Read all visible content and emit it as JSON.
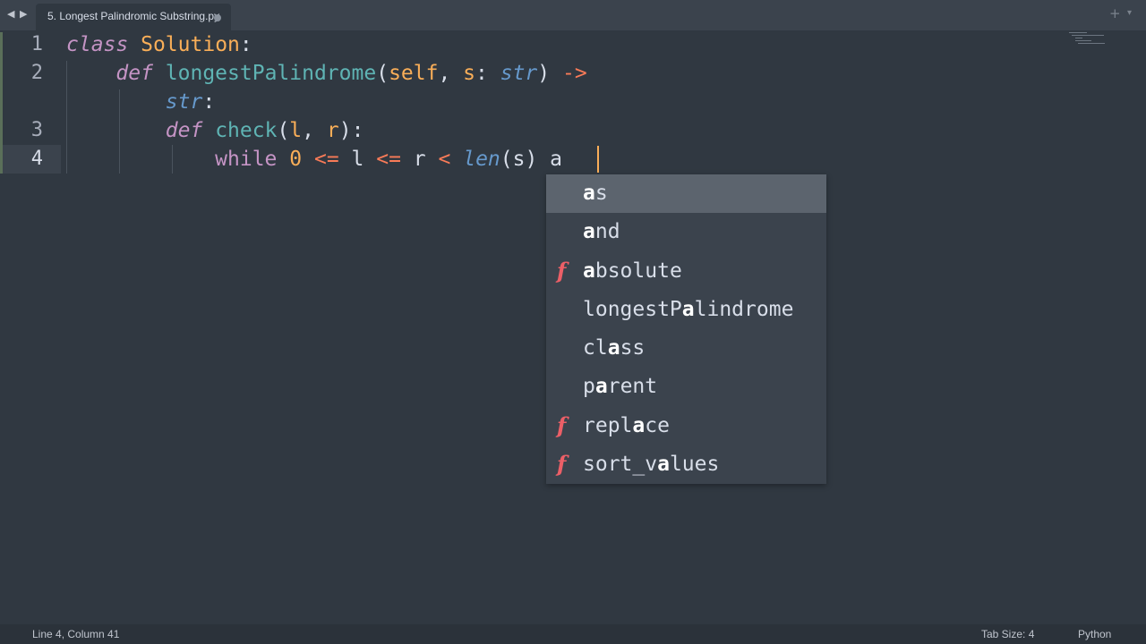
{
  "tab": {
    "title": "5. Longest Palindromic Substring.py"
  },
  "icons": {
    "back": "triangle-left-icon",
    "forward": "triangle-right-icon",
    "dirty": "dot-icon",
    "add": "plus-icon",
    "menu": "chevron-down-icon",
    "function": "f-function-icon"
  },
  "glyphs": {
    "back": "◀",
    "forward": "▶",
    "add": "+",
    "menu": "▾",
    "function": "f"
  },
  "editor": {
    "line_numbers": [
      "1",
      "2",
      "3",
      "4"
    ],
    "lines": {
      "l1": [
        "class",
        " ",
        "Solution",
        ":"
      ],
      "l2": [
        "    ",
        "def",
        " ",
        "longestPalindrome",
        "(",
        "self",
        ", ",
        "s",
        ": ",
        "str",
        ") ",
        "->"
      ],
      "l2b": [
        "        ",
        "str",
        ":"
      ],
      "l3": [
        "        ",
        "def",
        " ",
        "check",
        "(",
        "l",
        ", ",
        "r",
        "):"
      ],
      "l4": [
        "            ",
        "while",
        " ",
        "0",
        " ",
        "<=",
        " l ",
        "<=",
        " r ",
        "<",
        " ",
        "len",
        "(s) a"
      ]
    }
  },
  "autocomplete": {
    "items": [
      {
        "pre": "",
        "match": "a",
        "post": "s",
        "kind": ""
      },
      {
        "pre": "",
        "match": "a",
        "post": "nd",
        "kind": ""
      },
      {
        "pre": "",
        "match": "a",
        "post": "bsolute",
        "kind": "f"
      },
      {
        "pre": "longestP",
        "match": "a",
        "post": "lindrome",
        "kind": ""
      },
      {
        "pre": "cl",
        "match": "a",
        "post": "ss",
        "kind": ""
      },
      {
        "pre": "p",
        "match": "a",
        "post": "rent",
        "kind": ""
      },
      {
        "pre": "repl",
        "match": "a",
        "post": "ce",
        "kind": "f"
      },
      {
        "pre": "sort_v",
        "match": "a",
        "post": "lues",
        "kind": "f"
      }
    ]
  },
  "status": {
    "position": "Line 4, Column 41",
    "tab_size": "Tab Size: 4",
    "syntax": "Python"
  },
  "colors": {
    "background": "#303841",
    "keyword": "#c594c5",
    "function": "#5fb4b4",
    "class": "#f9ae58",
    "type": "#6699cc",
    "operator": "#f97b58",
    "kind_function": "#ec5f67"
  }
}
